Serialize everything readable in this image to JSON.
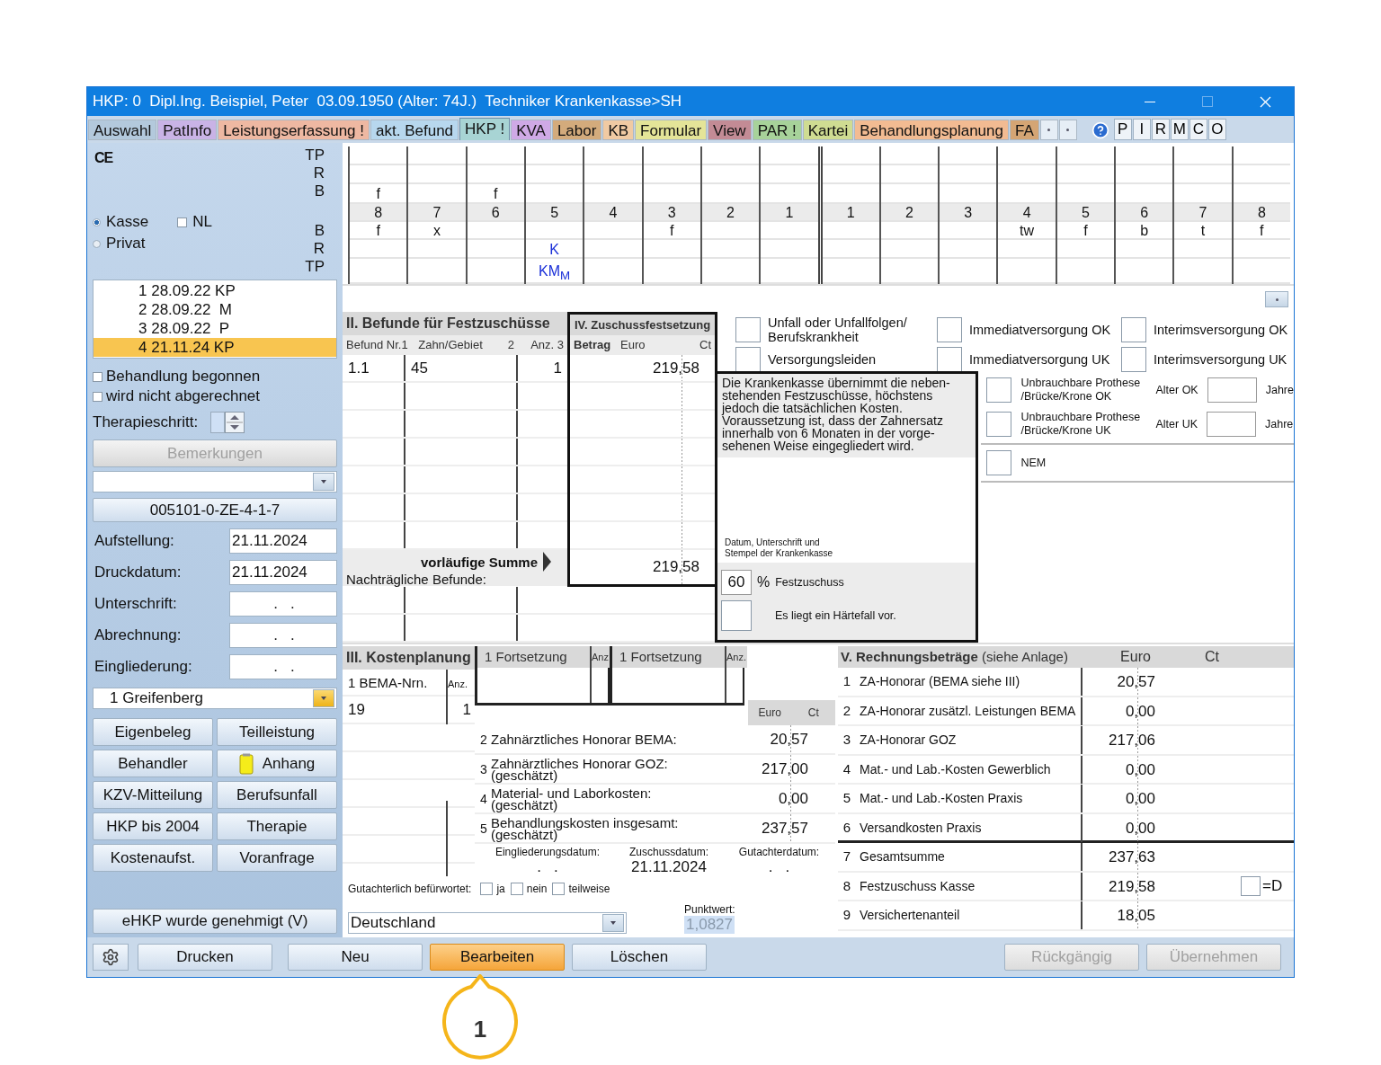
{
  "window": {
    "title": "HKP: 0  Dipl.Ing. Beispiel, Peter  03.09.1950 (Alter: 74J.)  Techniker Krankenkasse>SH"
  },
  "tabs": [
    {
      "label": "Auswahl",
      "color": "#b3c9dc",
      "selected": false
    },
    {
      "label": "PatInfo",
      "color": "#c9b3e6",
      "selected": false
    },
    {
      "label": "Leistungserfassung !",
      "color": "#eeb8a2",
      "selected": false
    },
    {
      "label": "akt. Befund",
      "color": "#b7d7ee",
      "selected": false
    },
    {
      "label": "HKP !",
      "color": "#a8d4d4",
      "selected": true
    },
    {
      "label": "KVA",
      "color": "#cfa9e6",
      "selected": false
    },
    {
      "label": "Labor",
      "color": "#d3ab7c",
      "selected": false
    },
    {
      "label": "KB",
      "color": "#f0caa3",
      "selected": false
    },
    {
      "label": "Formular",
      "color": "#e4e498",
      "selected": false
    },
    {
      "label": "View",
      "color": "#c38b95",
      "selected": false
    },
    {
      "label": "PAR !",
      "color": "#a7d29a",
      "selected": false
    },
    {
      "label": "Kartei",
      "color": "#cfdc92",
      "selected": false
    },
    {
      "label": "Behandlungsplanung",
      "color": "#f2bb92",
      "selected": false
    },
    {
      "label": "FA",
      "color": "#d4a574",
      "selected": false
    }
  ],
  "quick_buttons": [
    "P",
    "I",
    "R",
    "M",
    "C",
    "O"
  ],
  "sidebar": {
    "ce_mark": "CE",
    "row_labels_upper": [
      "TP",
      "R",
      "B"
    ],
    "row_labels_lower": [
      "B",
      "R",
      "TP"
    ],
    "insurance": [
      {
        "label": "Kasse",
        "selected": true
      },
      {
        "label": "Privat",
        "selected": false
      }
    ],
    "nl": {
      "label": "NL",
      "checked": false
    },
    "plans": [
      {
        "label": "1 28.09.22 KP",
        "selected": false
      },
      {
        "label": "2 28.09.22  M",
        "selected": false
      },
      {
        "label": "3 28.09.22  P",
        "selected": false
      },
      {
        "label": "4 21.11.24 KP",
        "selected": true
      }
    ],
    "flags": [
      {
        "label": "Behandlung begonnen",
        "checked": false
      },
      {
        "label": "wird nicht abgerechnet",
        "checked": false
      }
    ],
    "therapy_step_label": "Therapieschritt:",
    "remarks_button": {
      "label": "Bemerkungen",
      "disabled": true
    },
    "code_button": "005101-0-ZE-4-1-7",
    "dates": [
      {
        "label": "Aufstellung:",
        "value": "21.11.2024"
      },
      {
        "label": "Druckdatum:",
        "value": "21.11.2024"
      },
      {
        "label": "Unterschrift:",
        "value": ".   ."
      },
      {
        "label": "Abrechnung:",
        "value": ".   ."
      },
      {
        "label": "Eingliederung:",
        "value": ".   ."
      }
    ],
    "practice": "1 Greifenberg",
    "buttons": [
      {
        "label": "Eigenbeleg",
        "kind": "plain"
      },
      {
        "label": "Teilleistung",
        "kind": "plain"
      },
      {
        "label": "Behandler",
        "kind": "plain"
      },
      {
        "label": "Anhang",
        "kind": "note"
      },
      {
        "label": "KZV-Mitteilung",
        "kind": "plain"
      },
      {
        "label": "Berufsunfall",
        "kind": "plain"
      },
      {
        "label": "HKP bis 2004",
        "kind": "plain"
      },
      {
        "label": "Therapie",
        "kind": "plain"
      },
      {
        "label": "Kostenaufst.",
        "kind": "plain"
      },
      {
        "label": "Voranfrage",
        "kind": "plain"
      }
    ],
    "ehkp_button": "eHKP wurde genehmigt (V)"
  },
  "teeth": [
    {
      "number": "8",
      "upper_b": "f",
      "lower_b": "f"
    },
    {
      "number": "7",
      "lower_b": "x"
    },
    {
      "number": "6",
      "upper_b": "f"
    },
    {
      "number": "5",
      "lower_r": "K",
      "lower_tp": "KM$_{M}$"
    },
    {
      "number": "4"
    },
    {
      "number": "3",
      "lower_b": "f"
    },
    {
      "number": "2"
    },
    {
      "number": "1"
    },
    {
      "number": "1"
    },
    {
      "number": "2"
    },
    {
      "number": "3"
    },
    {
      "number": "4",
      "lower_b": "tw"
    },
    {
      "number": "5",
      "lower_b": "f"
    },
    {
      "number": "6",
      "lower_b": "b"
    },
    {
      "number": "7",
      "lower_b": "t"
    },
    {
      "number": "8",
      "lower_b": "f"
    }
  ],
  "befunde": {
    "title": "II. Befunde für Festzuschüsse",
    "columns": [
      "Befund Nr.1",
      "Zahn/Gebiet",
      "2",
      "Anz. 3"
    ],
    "rows": [
      {
        "befund": "1.1",
        "zahn": "45",
        "anz": "1"
      }
    ],
    "sum_label": "vorläufige Summe",
    "later_label": "Nachträgliche Befunde:"
  },
  "zuschuss": {
    "title": "IV. Zuschussfestsetzung",
    "columns": [
      "Betrag",
      "Euro",
      "Ct"
    ],
    "amounts": [
      "219,58"
    ],
    "sum": "219,58"
  },
  "options": [
    {
      "label": "Unfall oder Unfallfolgen/\nBerufskrankheit",
      "checked": false
    },
    {
      "label": "Immediatversorgung OK",
      "checked": false
    },
    {
      "label": "Interimsversorgung OK",
      "checked": false
    },
    {
      "label": "Versorgungsleiden",
      "checked": false
    },
    {
      "label": "Immediatversorgung UK",
      "checked": false
    },
    {
      "label": "Interimsversorgung UK",
      "checked": false
    }
  ],
  "kasse_box": {
    "notice": "Die Krankenkasse übernimmt die neben-\nstehenden Festzuschüsse, höchstens\njedoch die tatsächlichen Kosten.\nVoraussetzung ist, dass der Zahnersatz\ninnerhalb von 6 Monaten in der vorge-\nsehenen Weise eingegliedert wird.",
    "signature_label": "Datum, Unterschrift und\nStempel der Krankenkasse",
    "percent": "60",
    "percent_sign": "%",
    "percent_label": "Festzuschuss",
    "hardship": {
      "label": "Es liegt ein Härtefall vor.",
      "checked": false
    }
  },
  "prothese": [
    {
      "label": "Unbrauchbare Prothese\n/Brücke/Krone OK",
      "checked": false,
      "age_label": "Alter OK",
      "unit": "Jahre"
    },
    {
      "label": "Unbrauchbare Prothese\n/Brücke/Krone UK",
      "checked": false,
      "age_label": "Alter UK",
      "unit": "Jahre"
    }
  ],
  "nem": {
    "label": "NEM",
    "checked": false
  },
  "kosten": {
    "title": "III. Kostenplanung",
    "continuations": [
      {
        "label": "1 Fortsetzung",
        "count_label": "Anz."
      },
      {
        "label": "1 Fortsetzung",
        "count_label": "Anz."
      }
    ],
    "bema_columns": [
      "1 BEMA-Nrn.",
      "Anz."
    ],
    "bema_rows": [
      {
        "code": "19",
        "count": "1"
      }
    ],
    "amount_columns": [
      "Euro",
      "Ct"
    ],
    "lines": [
      {
        "number": "2",
        "label": "Zahnärztliches Honorar BEMA:",
        "amount": "20,57"
      },
      {
        "number": "3",
        "label": "Zahnärztliches Honorar GOZ:\n(geschätzt)",
        "amount": "217,00"
      },
      {
        "number": "4",
        "label": "Material- und Laborkosten:\n(geschätzt)",
        "amount": "0,00"
      },
      {
        "number": "5",
        "label": "Behandlungskosten insgesamt:\n(geschätzt)",
        "amount": "237,57"
      }
    ],
    "dates": [
      {
        "label": "Eingliederungsdatum:",
        "value": ".   ."
      },
      {
        "label": "Zuschussdatum:",
        "value": "21.11.2024"
      },
      {
        "label": "Gutachterdatum:",
        "value": ".   ."
      }
    ],
    "review": {
      "label": "Gutachterlich befürwortet:",
      "options": [
        {
          "label": "ja",
          "checked": false
        },
        {
          "label": "nein",
          "checked": false
        },
        {
          "label": "teilweise",
          "checked": false
        }
      ]
    },
    "country": "Deutschland",
    "point_value": {
      "label": "Punktwert:",
      "value": "1,0827"
    }
  },
  "rechnung": {
    "title": "V. Rechnungsbeträge",
    "subtitle": "(siehe Anlage)",
    "columns": [
      "Euro",
      "Ct"
    ],
    "rows": [
      {
        "number": "1",
        "label": "ZA-Honorar (BEMA siehe III)",
        "amount": "20,57"
      },
      {
        "number": "2",
        "label": "ZA-Honorar zusätzl. Leistungen BEMA",
        "amount": "0,00"
      },
      {
        "number": "3",
        "label": "ZA-Honorar GOZ",
        "amount": "217,06"
      },
      {
        "number": "4",
        "label": "Mat.- und Lab.-Kosten Gewerblich",
        "amount": "0,00"
      },
      {
        "number": "5",
        "label": "Mat.- und Lab.-Kosten Praxis",
        "amount": "0,00"
      },
      {
        "number": "6",
        "label": "Versandkosten Praxis",
        "amount": "0,00"
      },
      {
        "number": "7",
        "label": "Gesamtsumme",
        "amount": "237,63"
      },
      {
        "number": "8",
        "label": "Festzuschuss Kasse",
        "amount": "219,58",
        "flag": {
          "label": "=D",
          "checked": false
        }
      },
      {
        "number": "9",
        "label": "Versichertenanteil",
        "amount": "18,05"
      }
    ]
  },
  "bottom_bar": {
    "left": [
      {
        "label": "Drucken",
        "disabled": false,
        "highlighted": false
      },
      {
        "label": "Neu",
        "disabled": false,
        "highlighted": false
      },
      {
        "label": "Bearbeiten",
        "disabled": false,
        "highlighted": true
      },
      {
        "label": "Löschen",
        "disabled": false,
        "highlighted": false
      }
    ],
    "right": [
      {
        "label": "Rückgängig",
        "disabled": true,
        "highlighted": false
      },
      {
        "label": "Übernehmen",
        "disabled": true,
        "highlighted": false
      }
    ]
  },
  "callout": {
    "text": "1"
  }
}
